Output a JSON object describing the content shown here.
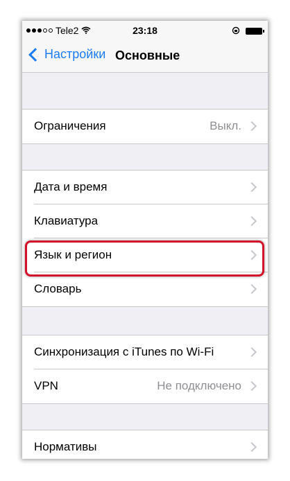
{
  "status_bar": {
    "carrier": "Tele2",
    "time": "23:18",
    "wifi_icon": "wifi-icon",
    "lock_icon": "orientation-lock-icon",
    "battery_icon": "battery-icon"
  },
  "nav": {
    "back_label": "Настройки",
    "title": "Основные"
  },
  "groups": {
    "restrictions": {
      "label": "Ограничения",
      "value": "Выкл."
    },
    "date_time": {
      "label": "Дата и время"
    },
    "keyboard": {
      "label": "Клавиатура"
    },
    "language": {
      "label": "Язык и регион"
    },
    "dictionary": {
      "label": "Словарь"
    },
    "itunes_sync": {
      "label": "Синхронизация с iTunes по Wi-Fi"
    },
    "vpn": {
      "label": "VPN",
      "value": "Не подключено"
    },
    "regulatory": {
      "label": "Нормативы"
    }
  },
  "colors": {
    "accent": "#1a7cf5",
    "highlight": "#d3112a"
  }
}
